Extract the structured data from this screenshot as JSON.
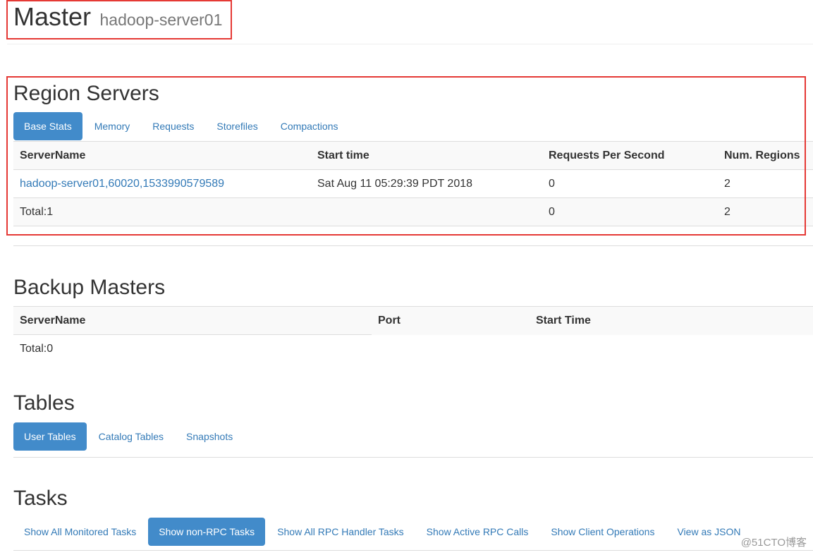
{
  "header": {
    "title": "Master",
    "subtitle": "hadoop-server01"
  },
  "region_servers": {
    "title": "Region Servers",
    "tabs": [
      {
        "label": "Base Stats",
        "active": true
      },
      {
        "label": "Memory",
        "active": false
      },
      {
        "label": "Requests",
        "active": false
      },
      {
        "label": "Storefiles",
        "active": false
      },
      {
        "label": "Compactions",
        "active": false
      }
    ],
    "columns": [
      "ServerName",
      "Start time",
      "Requests Per Second",
      "Num. Regions"
    ],
    "rows": [
      [
        "hadoop-server01,60020,1533990579589",
        "Sat Aug 11 05:29:39 PDT 2018",
        "0",
        "2"
      ]
    ],
    "total": [
      "Total:1",
      "",
      "0",
      "2"
    ]
  },
  "backup_masters": {
    "title": "Backup Masters",
    "columns": [
      "ServerName",
      "Port",
      "Start Time"
    ],
    "total": "Total:0"
  },
  "tables": {
    "title": "Tables",
    "tabs": [
      {
        "label": "User Tables",
        "active": true
      },
      {
        "label": "Catalog Tables",
        "active": false
      },
      {
        "label": "Snapshots",
        "active": false
      }
    ]
  },
  "tasks": {
    "title": "Tasks",
    "tabs": [
      {
        "label": "Show All Monitored Tasks",
        "active": false
      },
      {
        "label": "Show non-RPC Tasks",
        "active": true
      },
      {
        "label": "Show All RPC Handler Tasks",
        "active": false
      },
      {
        "label": "Show Active RPC Calls",
        "active": false
      },
      {
        "label": "Show Client Operations",
        "active": false
      },
      {
        "label": "View as JSON",
        "active": false
      }
    ]
  },
  "watermark": "@51CTO博客",
  "colors": {
    "accent": "#428bca",
    "link": "#337ab7",
    "annotation": "#e53935"
  }
}
